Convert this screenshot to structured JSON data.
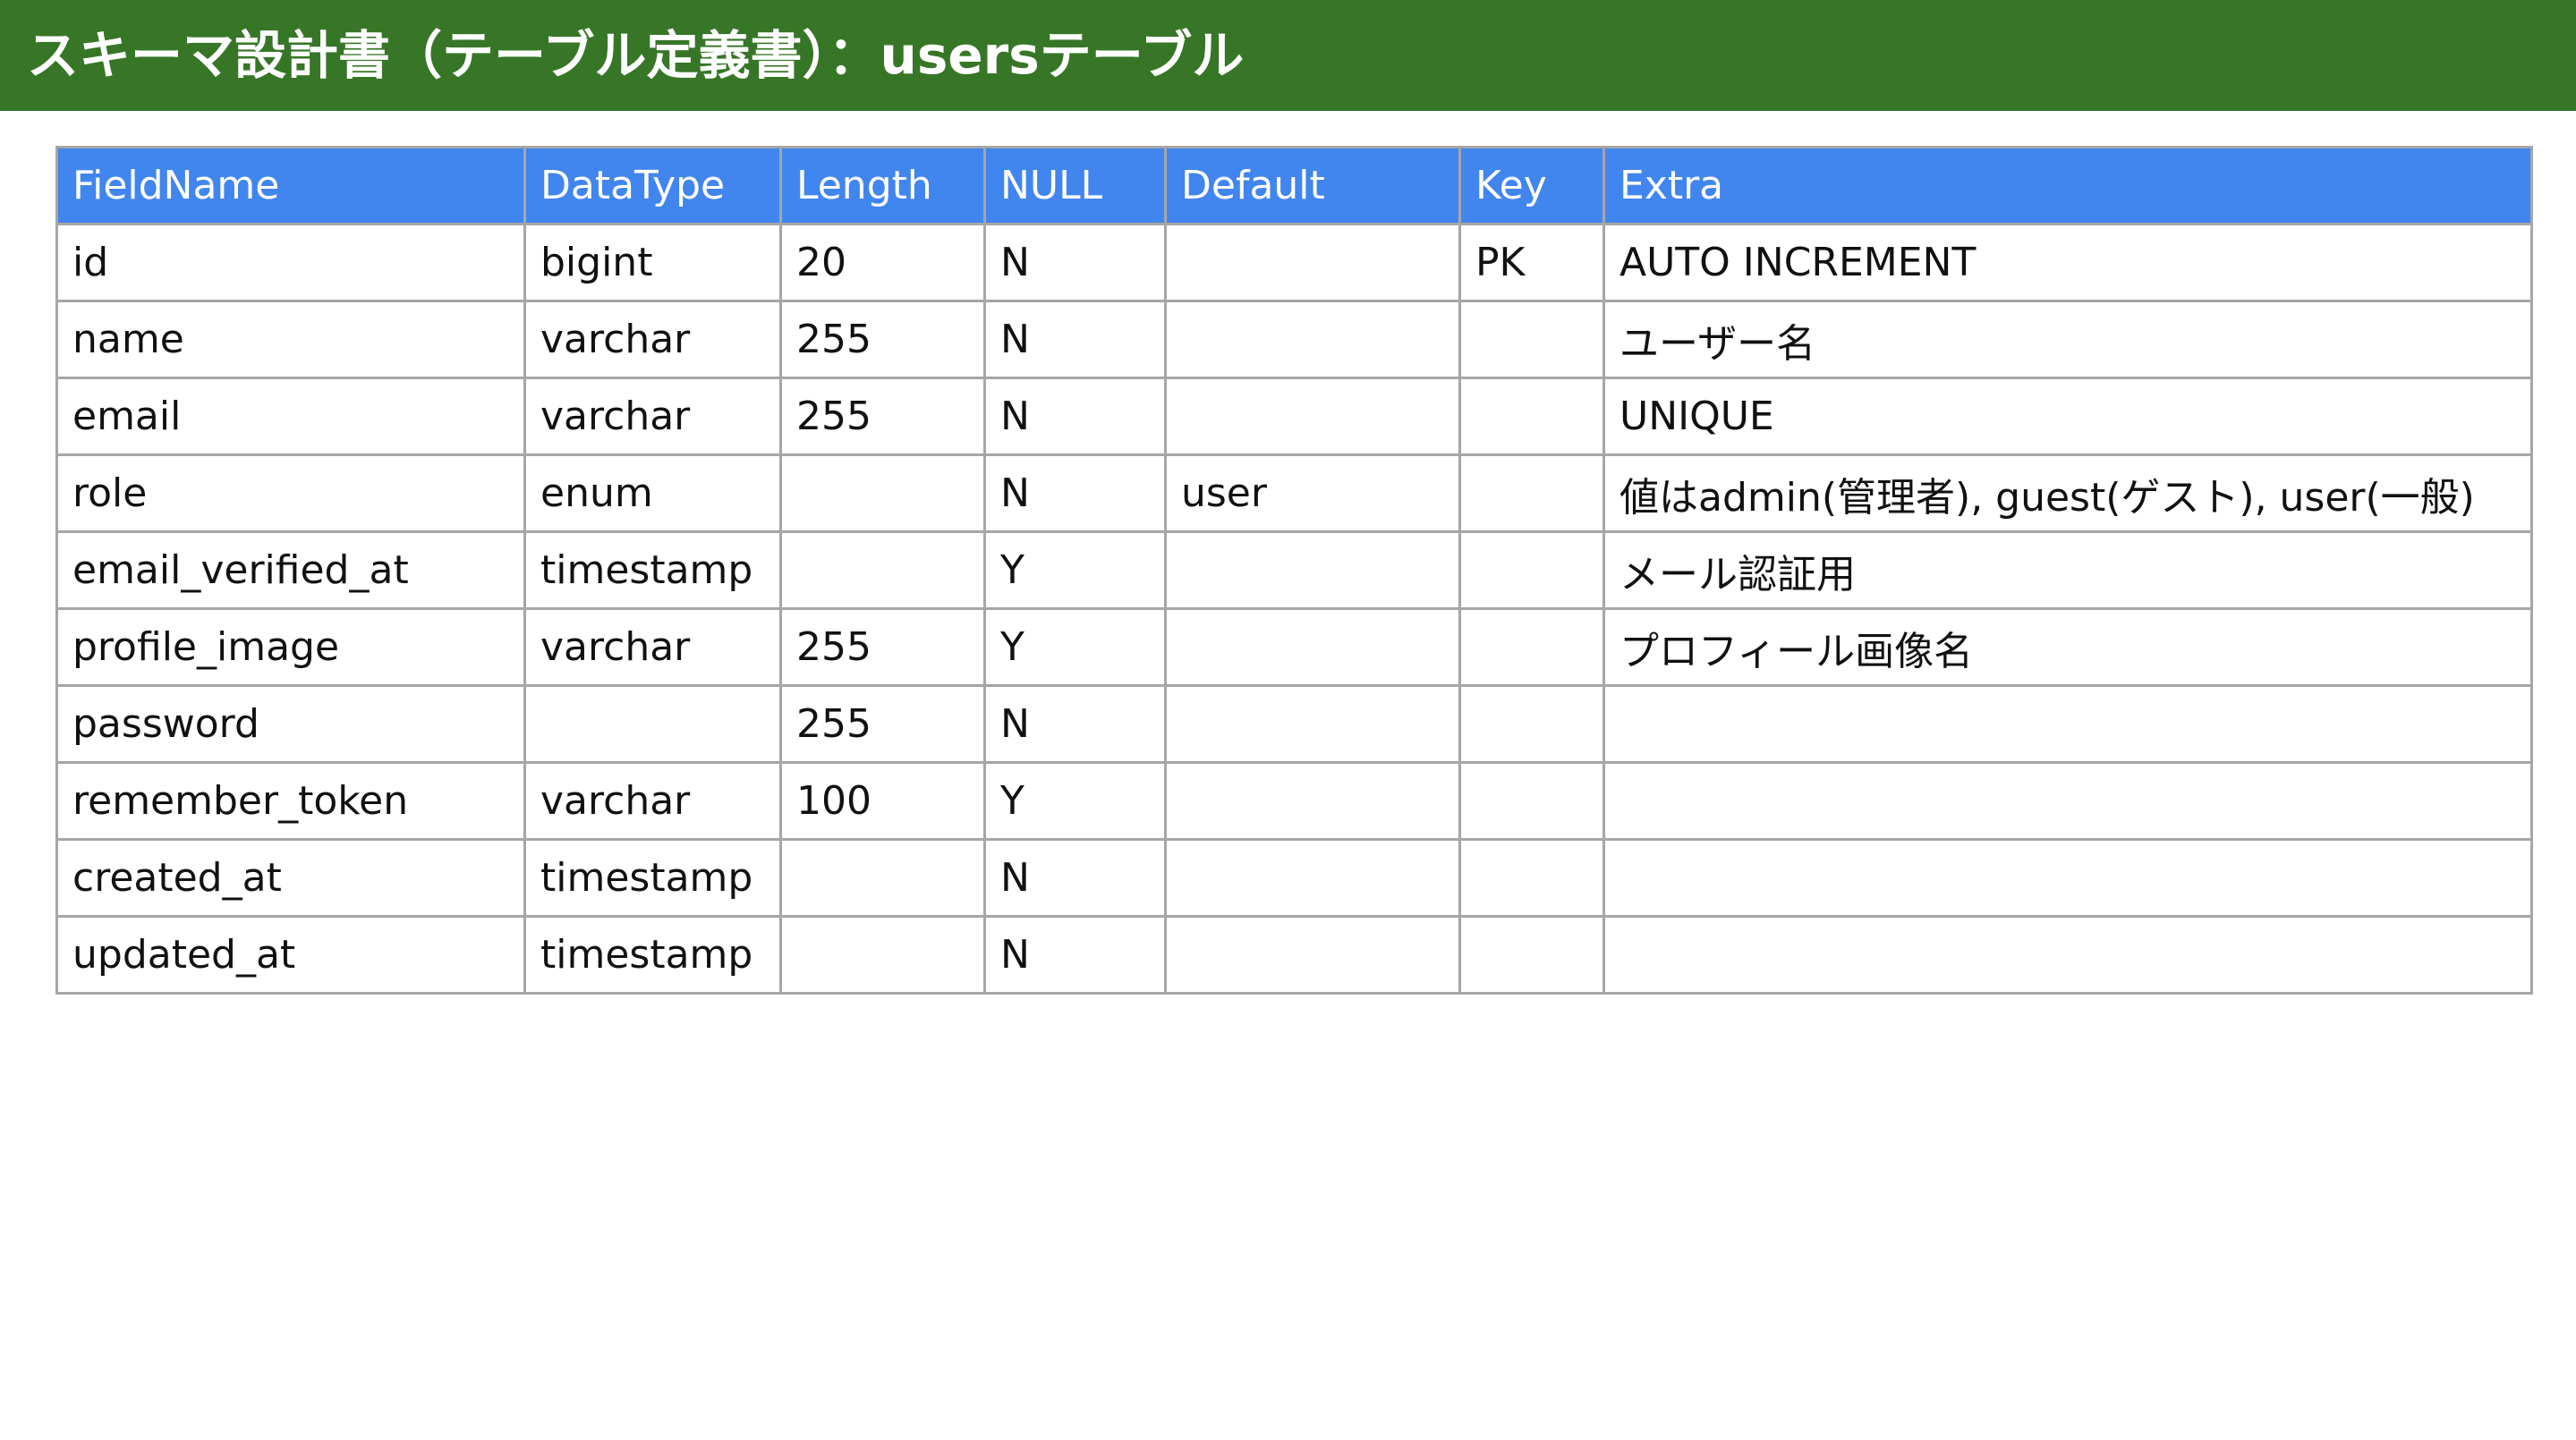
{
  "header": {
    "title": "スキーマ設計書（テーブル定義書）：usersテーブル"
  },
  "colors": {
    "header_background": "#377627",
    "table_header_background": "#4185ee",
    "table_header_text": "#ffffff",
    "grid_line": "#a6a6a6"
  },
  "table": {
    "columns": [
      "FieldName",
      "DataType",
      "Length",
      "NULL",
      "Default",
      "Key",
      "Extra"
    ],
    "rows": [
      [
        "id",
        "bigint",
        "20",
        "N",
        "",
        "PK",
        "AUTO INCREMENT"
      ],
      [
        "name",
        "varchar",
        "255",
        "N",
        "",
        "",
        "ユーザー名"
      ],
      [
        "email",
        "varchar",
        "255",
        "N",
        "",
        "",
        "UNIQUE"
      ],
      [
        "role",
        "enum",
        "",
        "N",
        "user",
        "",
        "値はadmin(管理者), guest(ゲスト), user(一般)"
      ],
      [
        "email_verified_at",
        "timestamp",
        "",
        "Y",
        "",
        "",
        "メール認証用"
      ],
      [
        "profile_image",
        "varchar",
        "255",
        "Y",
        "",
        "",
        "プロフィール画像名"
      ],
      [
        "password",
        "",
        "255",
        "N",
        "",
        "",
        ""
      ],
      [
        "remember_token",
        "varchar",
        "100",
        "Y",
        "",
        "",
        ""
      ],
      [
        "created_at",
        "timestamp",
        "",
        "N",
        "",
        "",
        ""
      ],
      [
        "updated_at",
        "timestamp",
        "",
        "N",
        "",
        "",
        ""
      ]
    ]
  }
}
